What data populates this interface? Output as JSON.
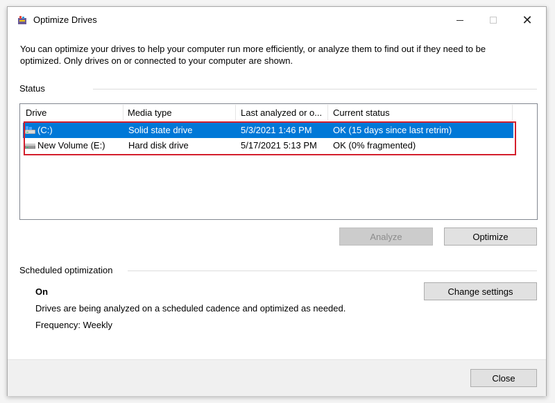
{
  "window": {
    "title": "Optimize Drives"
  },
  "description": "You can optimize your drives to help your computer run more efficiently, or analyze them to find out if they need to be optimized. Only drives on or connected to your computer are shown.",
  "status": {
    "label": "Status",
    "columns": [
      "Drive",
      "Media type",
      "Last analyzed or o...",
      "Current status"
    ],
    "drives": [
      {
        "drive": "(C:)",
        "media_type": "Solid state drive",
        "last_analyzed": "5/3/2021 1:46 PM",
        "current_status": "OK (15 days since last retrim)",
        "icon": "ssd-drive-icon",
        "selected": true
      },
      {
        "drive": "New Volume (E:)",
        "media_type": "Hard disk drive",
        "last_analyzed": "5/17/2021 5:13 PM",
        "current_status": "OK (0% fragmented)",
        "icon": "hdd-drive-icon",
        "selected": false
      }
    ]
  },
  "buttons": {
    "analyze": "Analyze",
    "optimize": "Optimize",
    "change_settings": "Change settings",
    "close": "Close"
  },
  "scheduled": {
    "label": "Scheduled optimization",
    "state": "On",
    "description": "Drives are being analyzed on a scheduled cadence and optimized as needed.",
    "frequency": "Frequency: Weekly"
  },
  "colors": {
    "selection": "#0078d7",
    "highlight_border": "#d41e2c"
  }
}
